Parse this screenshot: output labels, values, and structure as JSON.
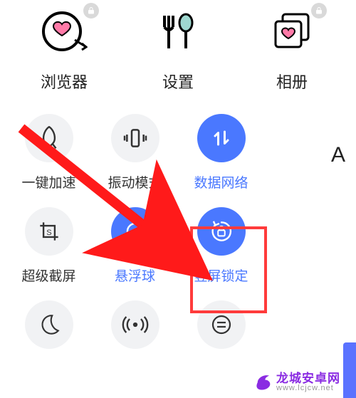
{
  "apps": [
    {
      "label": "浏览器",
      "icon": "browser-heart",
      "locked": true
    },
    {
      "label": "设置",
      "icon": "settings-utensils",
      "locked": false
    },
    {
      "label": "相册",
      "icon": "gallery-heart",
      "locked": true
    }
  ],
  "corner_letter": "A",
  "tiles_row1": [
    {
      "label": "一键加速",
      "icon": "rocket",
      "active": false,
      "interactable": true
    },
    {
      "label": "振动模式",
      "icon": "vibrate",
      "active": false,
      "interactable": true
    },
    {
      "label": "数据网络",
      "icon": "data-arrows",
      "active": true,
      "interactable": true
    }
  ],
  "tiles_row2": [
    {
      "label": "超级截屏",
      "icon": "crop-s",
      "active": false,
      "interactable": true
    },
    {
      "label": "悬浮球",
      "icon": "target",
      "active": true,
      "interactable": true
    },
    {
      "label": "竖屏锁定",
      "icon": "rotate-lock",
      "active": true,
      "interactable": true
    }
  ],
  "tiles_row3_icons": [
    "moon",
    "hotspot",
    "equal-circle"
  ],
  "highlight_target": "竖屏锁定",
  "watermark": {
    "name": "龙城安卓网",
    "domain": "www.lcjcw.net"
  }
}
